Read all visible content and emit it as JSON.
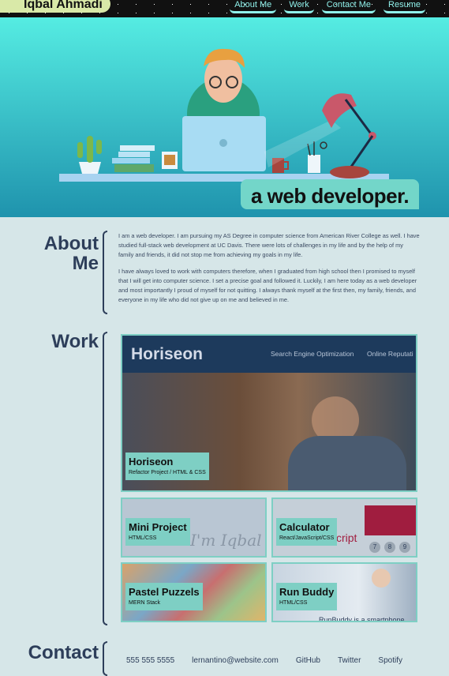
{
  "header": {
    "name": "Iqbal Ahmadi",
    "nav": [
      "About Me",
      "Work",
      "Contact Me",
      "Resume"
    ]
  },
  "hero": {
    "tagline": "a web developer."
  },
  "about": {
    "title_line1": "About",
    "title_line2": "Me",
    "p1": "I am a web developer. I am pursuing my AS Degree in computer science from American River College as well. I have studied full-stack web development at UC Davis. There were lots of challenges in my life and by the help of my family and friends, it did not stop me from achieving my goals in my life.",
    "p2": "I have always loved to work with computers therefore, when I graduated from high school then I promised to myself that I will get into computer science. I set a precise goal and followed it. Luckily, I am here today as a web developer and most importantly I proud of myself for not quitting. I always thank myself at the first then, my family, friends, and everyone in my life who did not give up on me and believed in me."
  },
  "work": {
    "title": "Work",
    "featured": {
      "site_logo": "Horiseon",
      "site_nav": [
        "Search Engine Optimization",
        "Online Reputati"
      ],
      "title": "Horiseon",
      "subtitle": "Refactor Project / HTML & CSS"
    },
    "projects": [
      {
        "title": "Mini Project",
        "subtitle": "HTML/CSS"
      },
      {
        "title": "Calculator",
        "subtitle": "React/JavaScript/CSS"
      },
      {
        "title": "Pastel Puzzels",
        "subtitle": "MERN Stack"
      },
      {
        "title": "Run Buddy",
        "subtitle": "HTML/CSS"
      }
    ],
    "mini_bg_text": "I'm Iqbal",
    "calc_keys": [
      "7",
      "8",
      "9"
    ],
    "calc_frag": "cript",
    "runbuddy_bg_text": "RunBuddy is a smartphone"
  },
  "contact": {
    "title": "Contact",
    "links": [
      "555 555 5555",
      "lernantino@website.com",
      "GitHub",
      "Twitter",
      "Spotify"
    ]
  }
}
